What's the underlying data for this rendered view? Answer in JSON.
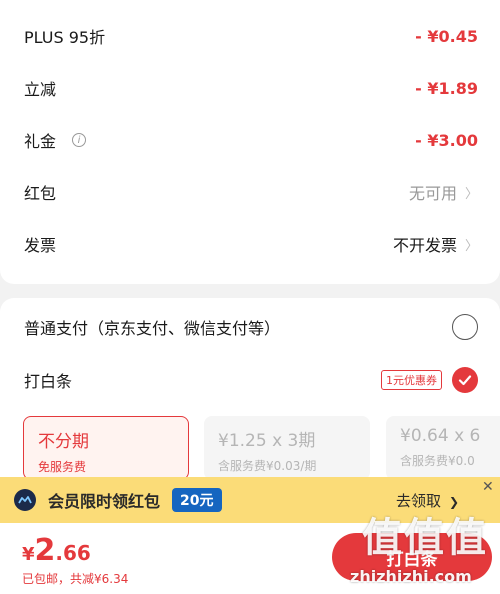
{
  "discounts": {
    "plus": {
      "label": "PLUS 95折",
      "value": "- ¥0.45"
    },
    "instant": {
      "label": "立减",
      "value": "- ¥1.89"
    },
    "gift": {
      "label": "礼金",
      "value": "- ¥3.00"
    },
    "red_packet": {
      "label": "红包",
      "value": "无可用"
    },
    "invoice": {
      "label": "发票",
      "value": "不开发票"
    }
  },
  "payment": {
    "normal_label": "普通支付（京东支付、微信支付等）",
    "baitiao_label": "打白条",
    "coupon_badge": "1元优惠券",
    "plans": [
      {
        "title": "不分期",
        "sub": "免服务费"
      },
      {
        "title": "¥1.25 x 3期",
        "sub": "含服务费¥0.03/期"
      },
      {
        "title": "¥0.64 x 6",
        "sub": "含服务费¥0.0"
      }
    ]
  },
  "banner": {
    "text": "会员限时领红包",
    "amount": "20元",
    "action": "去领取"
  },
  "footer": {
    "currency": "¥",
    "price_int": "2",
    "price_dec": ".66",
    "saving": "已包邮，共减¥6.34",
    "pay_button": "打白条"
  },
  "watermark": {
    "logo_text": "值值值",
    "site": "zhizhizhi.com"
  },
  "colors": {
    "accent": "#e4393c",
    "banner": "#fbdc78",
    "badge": "#1565c0"
  }
}
